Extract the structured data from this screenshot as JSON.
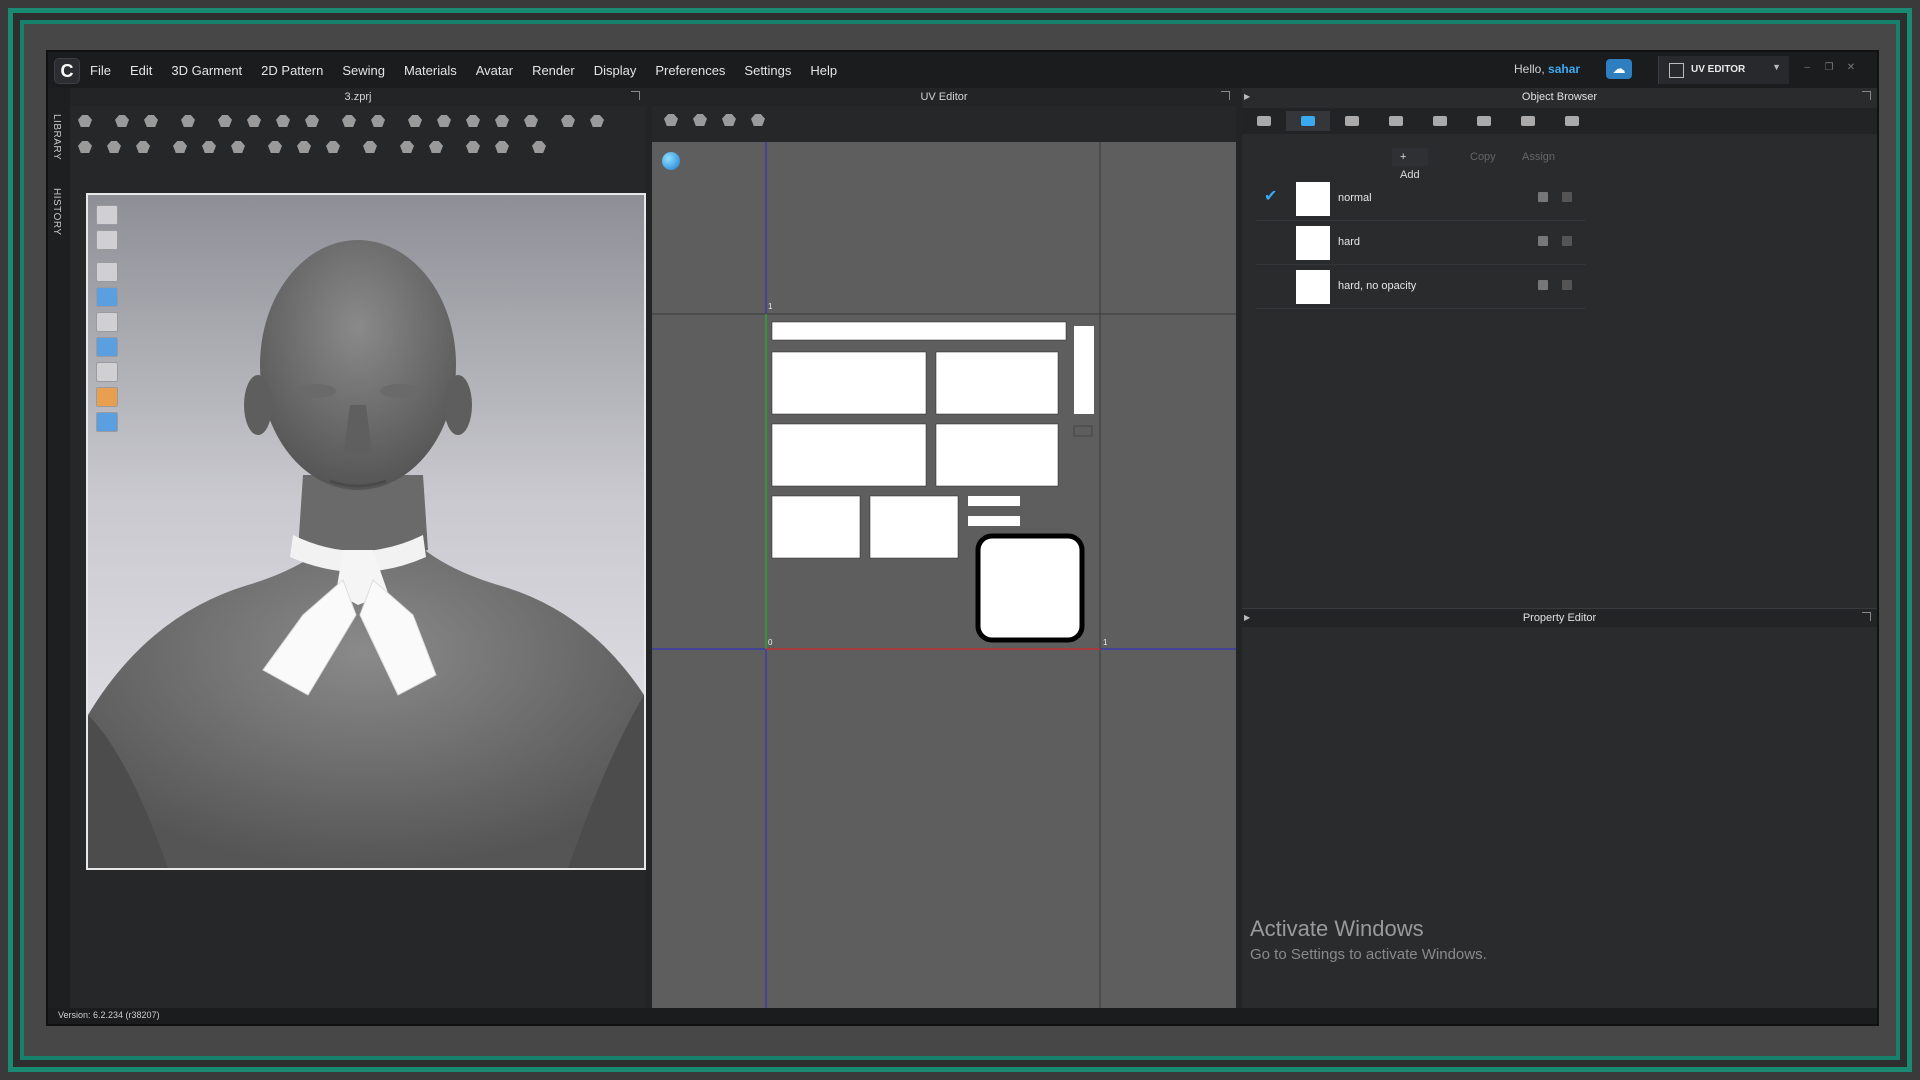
{
  "menu": {
    "items": [
      "File",
      "Edit",
      "3D Garment",
      "2D Pattern",
      "Sewing",
      "Materials",
      "Avatar",
      "Render",
      "Display",
      "Preferences",
      "Settings",
      "Help"
    ]
  },
  "user": {
    "greeting": "Hello,",
    "name": "sahar"
  },
  "mode": {
    "label": "UV EDITOR"
  },
  "side_tabs": {
    "library": "LIBRARY",
    "history": "HISTORY"
  },
  "viewport3d": {
    "title": "3.zprj"
  },
  "uv_editor": {
    "title": "UV Editor",
    "axis_labels": {
      "top_left": "1",
      "origin": "0",
      "right": "1"
    }
  },
  "object_browser": {
    "title": "Object Browser",
    "actions": {
      "add": "+ Add",
      "copy": "Copy",
      "assign": "Assign"
    },
    "materials": [
      {
        "name": "normal",
        "selected": true
      },
      {
        "name": "hard",
        "selected": false
      },
      {
        "name": "hard, no opacity",
        "selected": false
      }
    ]
  },
  "property_editor": {
    "title": "Property Editor"
  },
  "watermark": {
    "title": "Activate Windows",
    "subtitle": "Go to Settings to activate Windows."
  },
  "status": {
    "version": "Version: 6.2.234 (r38207)"
  },
  "colors": {
    "accent": "#3aa9f0",
    "frame": "#1a8a72",
    "uv_axis_x": "#c03030",
    "uv_axis_y": "#30a030",
    "uv_grid": "#2a2ad0"
  }
}
